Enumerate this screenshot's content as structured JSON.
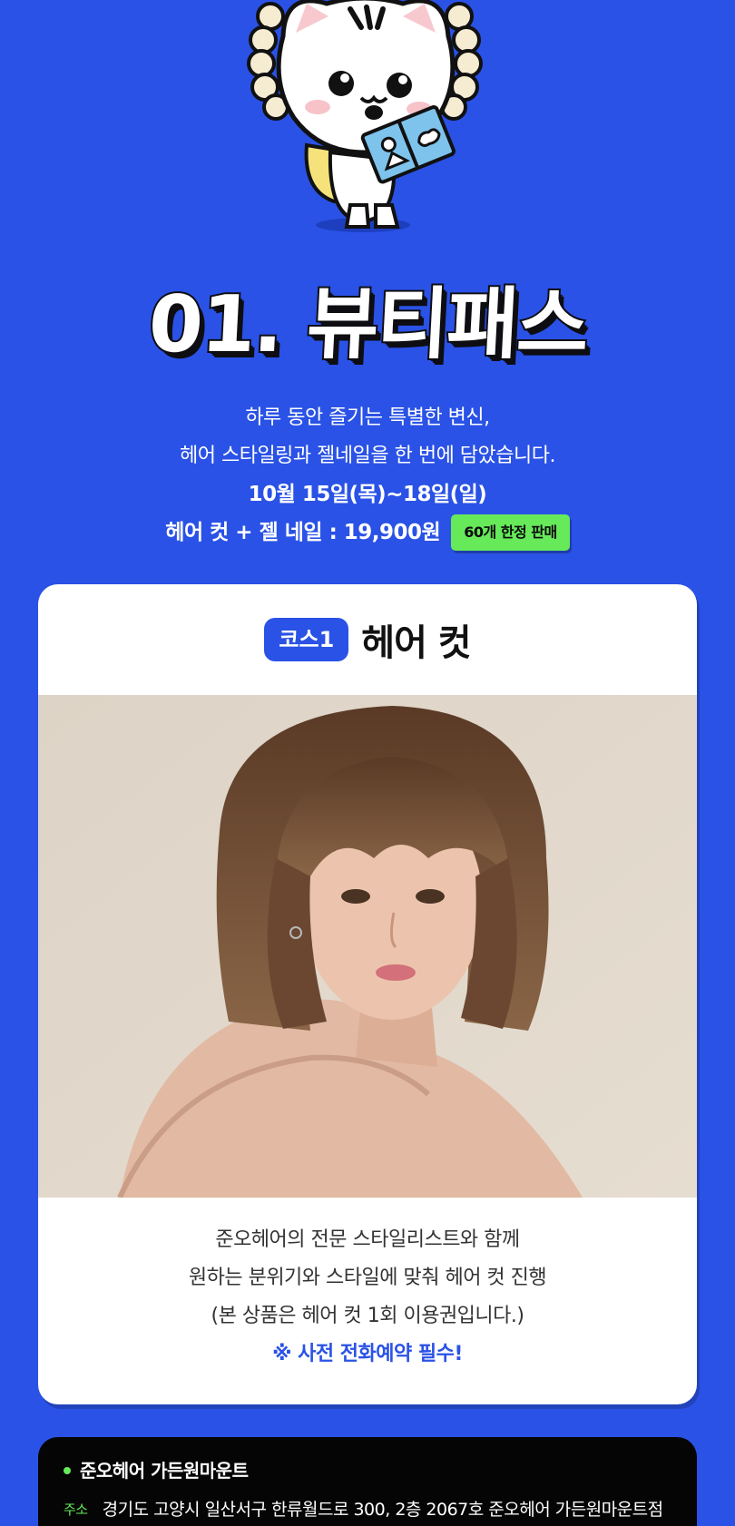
{
  "headline": "01. 뷰티패스",
  "intro": {
    "line1": "하루 동안 즐기는 특별한 변신,",
    "line2": "헤어 스타일링과 젤네일을 한 번에 담았습니다.",
    "dates": "10월 15일(목)~18일(일)",
    "price": "헤어 컷 + 젤 네일 : 19,900원",
    "badge": "60개 한정 판매"
  },
  "course": {
    "chip": "코스1",
    "title": "헤어 컷",
    "desc1": "준오헤어의 전문 스타일리스트와 함께",
    "desc2": "원하는 분위기와 스타일에 맞춰 헤어 컷 진행",
    "desc3": "(본 상품은 헤어 컷 1회 이용권입니다.)",
    "notice": "※ 사전 전화예약 필수!"
  },
  "store": {
    "name": "준오헤어 가든원마운트",
    "address_label": "주소",
    "address": "경기도 고양시 일산서구 한류월드로 300, 2층 2067호 준오헤어 가든원마운트점"
  },
  "colors": {
    "background": "#2a52e6",
    "accent_green": "#66ea5a",
    "card": "#ffffff",
    "store_panel": "#050505"
  }
}
